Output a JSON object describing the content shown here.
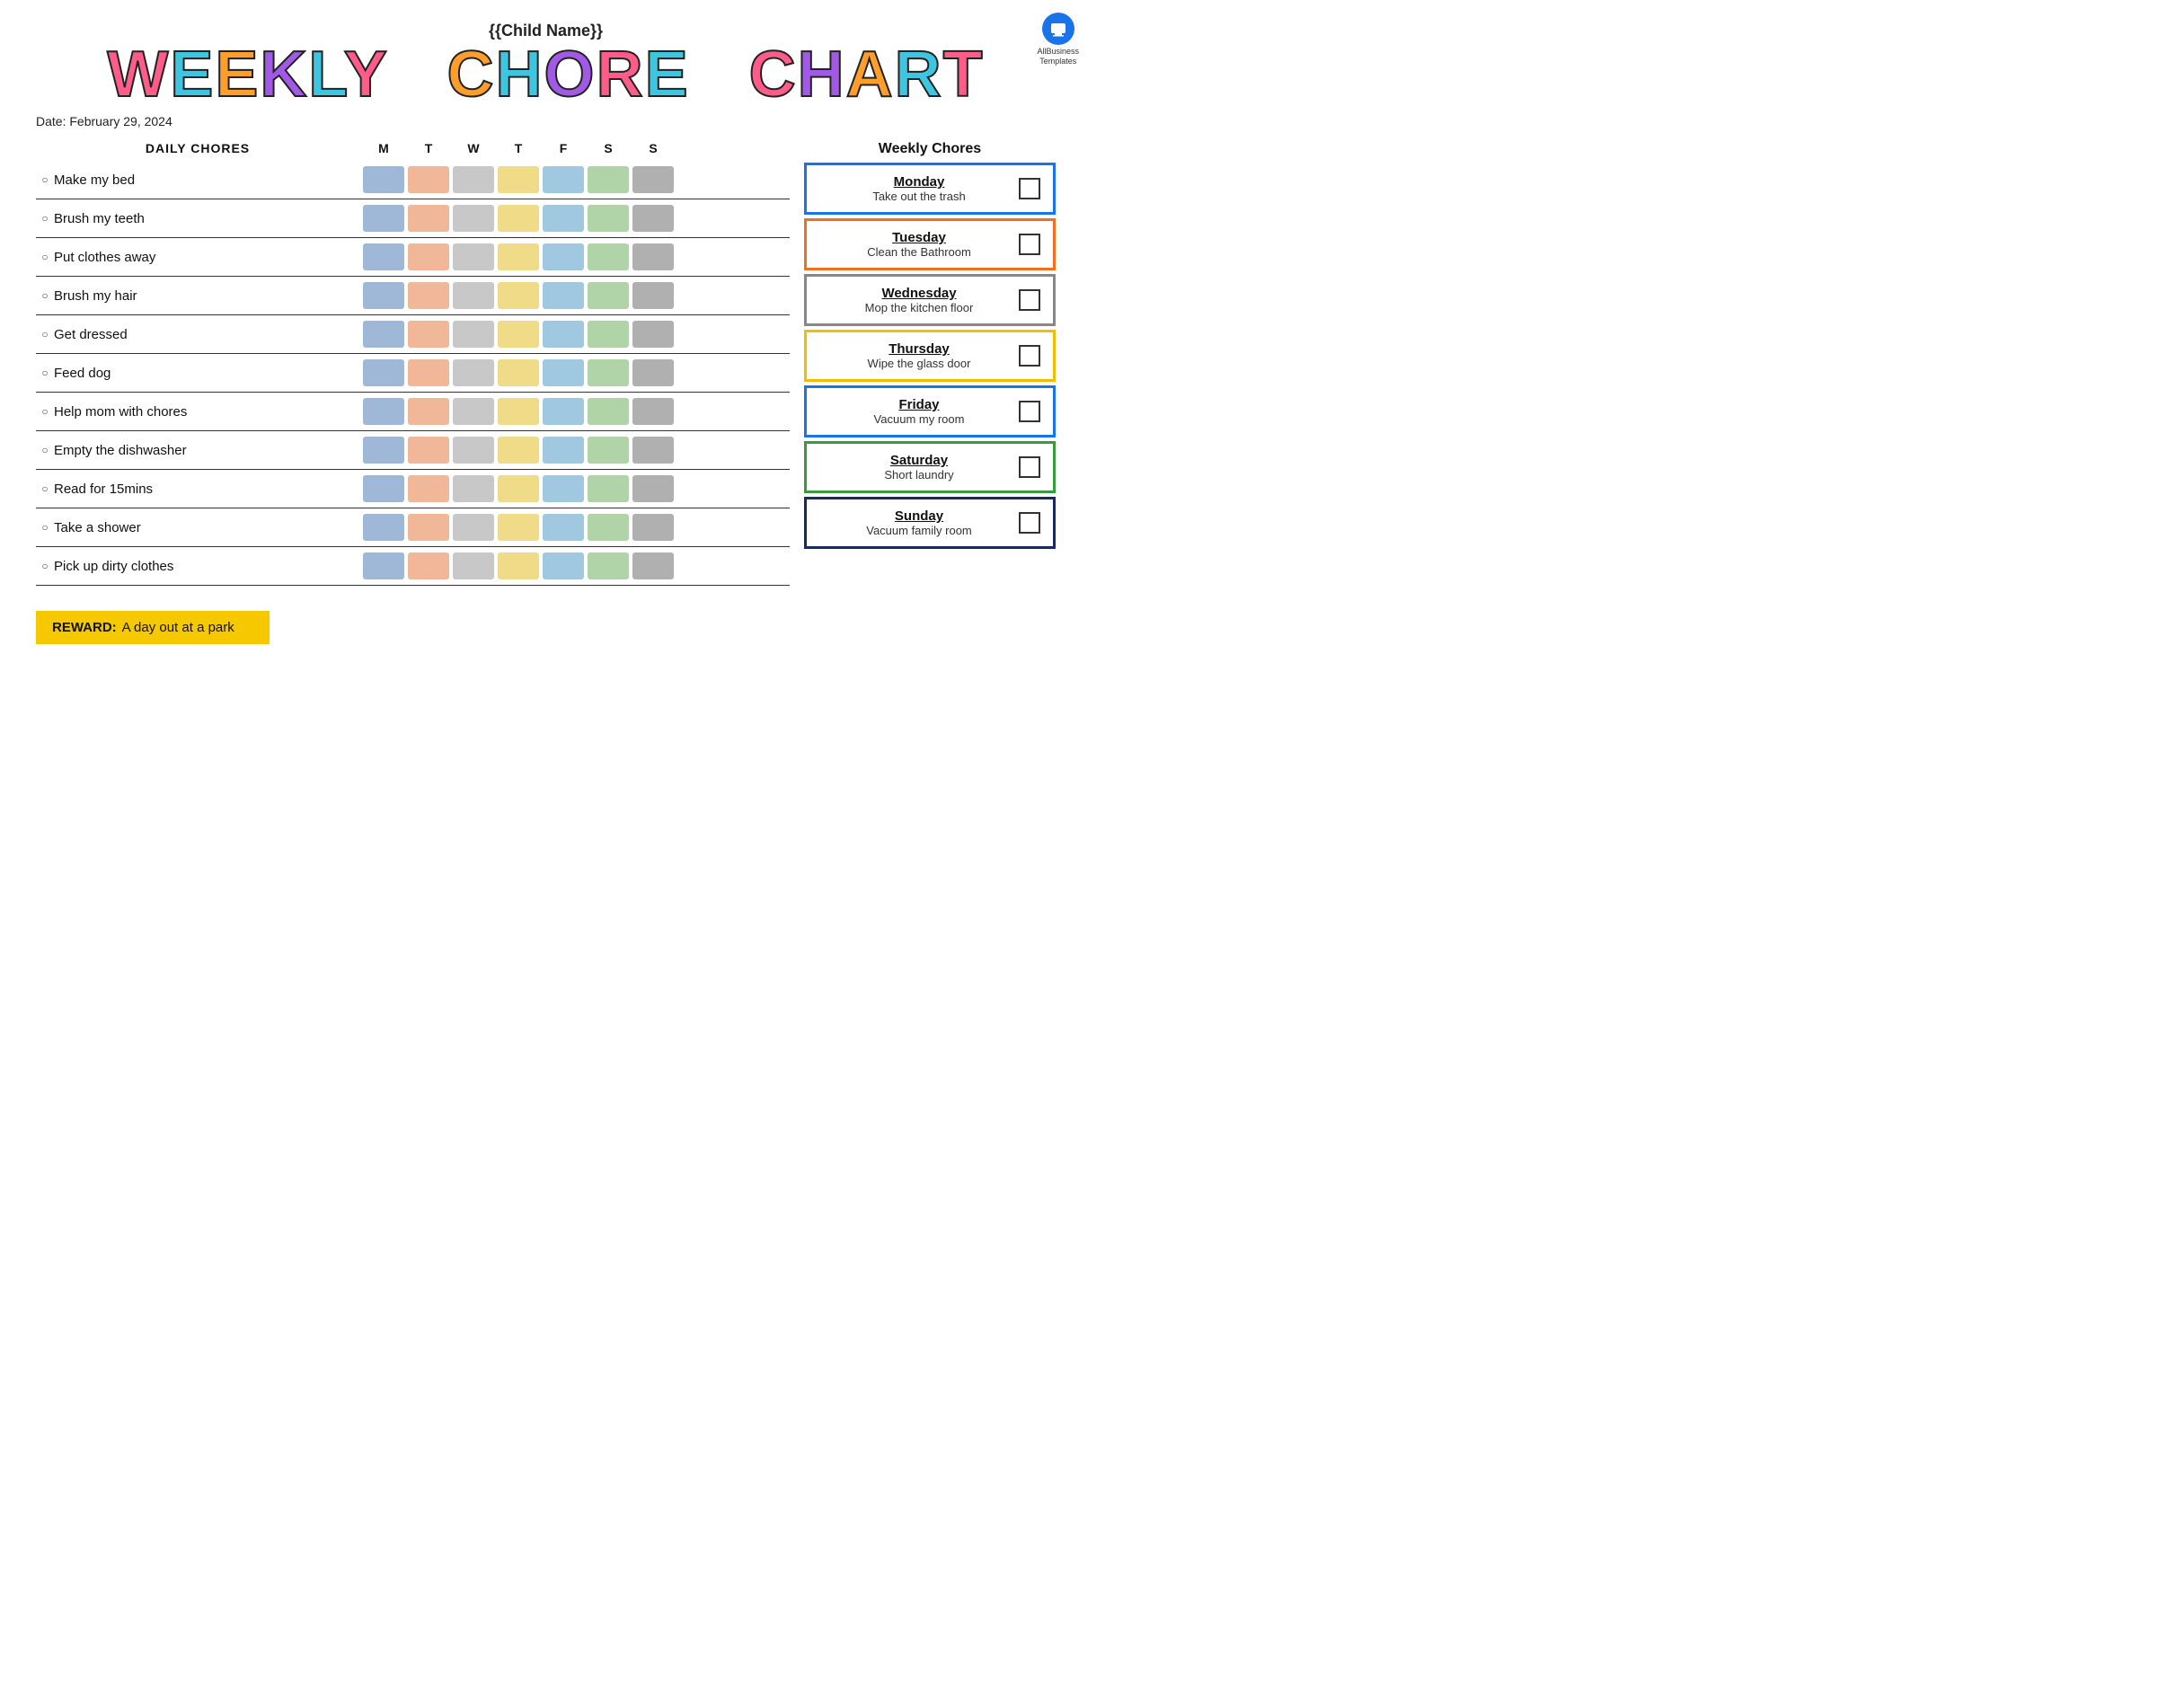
{
  "logo": {
    "line1": "AllBusiness",
    "line2": "Templates"
  },
  "header": {
    "child_name_placeholder": "{{Child Name}}",
    "title_word1": "WEEKLY",
    "title_word2": "CHORE",
    "title_word3": "CHART",
    "date_label": "Date: February 29, 2024"
  },
  "table": {
    "column_label": "DAILY CHORES",
    "day_headers": [
      "M",
      "T",
      "W",
      "T",
      "F",
      "S",
      "S"
    ],
    "chores": [
      "Make my bed",
      "Brush my teeth",
      "Put clothes away",
      "Brush my hair",
      "Get dressed",
      "Feed dog",
      "Help mom with chores",
      "Empty the dishwasher",
      "Read for 15mins",
      "Take a shower",
      "Pick up dirty clothes"
    ]
  },
  "reward": {
    "label": "REWARD:",
    "text": "A day out at a park"
  },
  "weekly_header": "Weekly Chores",
  "weekly_chores": [
    {
      "day": "Monday",
      "chore": "Take out the trash",
      "border": "blue"
    },
    {
      "day": "Tuesday",
      "chore": "Clean the Bathroom",
      "border": "orange"
    },
    {
      "day": "Wednesday",
      "chore": "Mop the kitchen floor",
      "border": "gray"
    },
    {
      "day": "Thursday",
      "chore": "Wipe the glass door",
      "border": "yellow"
    },
    {
      "day": "Friday",
      "chore": "Vacuum my room",
      "border": "blue2"
    },
    {
      "day": "Saturday",
      "chore": "Short laundry",
      "border": "green"
    },
    {
      "day": "Sunday",
      "chore": "Vacuum family room",
      "border": "navy"
    }
  ]
}
